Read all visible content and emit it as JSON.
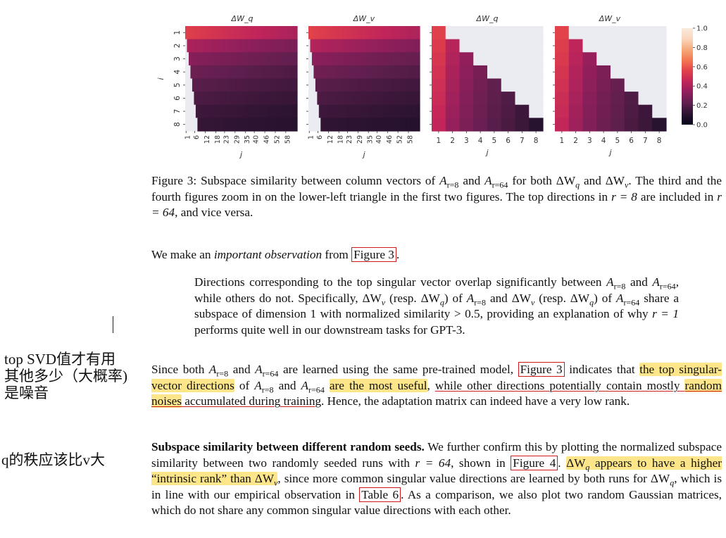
{
  "figure": {
    "panel_titles": [
      "ΔW_q",
      "ΔW_v",
      "ΔW_q",
      "ΔW_v"
    ],
    "ylabel": "i",
    "xlabel": "j",
    "row_ticks": [
      "1",
      "2",
      "3",
      "4",
      "5",
      "6",
      "7",
      "8"
    ],
    "wide_xticks": [
      "1",
      "6",
      "12",
      "18",
      "23",
      "29",
      "35",
      "40",
      "46",
      "52",
      "58"
    ],
    "zoom_xticks": [
      "1",
      "2",
      "3",
      "4",
      "5",
      "6",
      "7",
      "8"
    ],
    "colorbar_ticks": [
      "0.0",
      "0.2",
      "0.4",
      "0.6",
      "0.8",
      "1.0"
    ],
    "colormap": [
      "#03051a",
      "#2b1331",
      "#5e1f4e",
      "#8f1f5c",
      "#c1255a",
      "#e1414a",
      "#f37651",
      "#f6a97a",
      "#f8d6bd",
      "#faebdd"
    ]
  },
  "chart_data": [
    {
      "type": "heatmap",
      "title": "ΔW_q",
      "xlabel": "j",
      "ylabel": "i",
      "x_tick_labels": [
        "1",
        "6",
        "12",
        "18",
        "23",
        "29",
        "35",
        "40",
        "46",
        "52",
        "58"
      ],
      "y_tick_labels": [
        "1",
        "2",
        "3",
        "4",
        "5",
        "6",
        "7",
        "8"
      ],
      "row_values": [
        0.55,
        0.4,
        0.32,
        0.26,
        0.22,
        0.19,
        0.16,
        0.14
      ],
      "masked": "lower-left triangle (j < i) shown blank",
      "colorbar_range": [
        0.0,
        1.0
      ]
    },
    {
      "type": "heatmap",
      "title": "ΔW_v",
      "xlabel": "j",
      "ylabel": "i",
      "x_tick_labels": [
        "1",
        "6",
        "12",
        "18",
        "23",
        "29",
        "35",
        "40",
        "46",
        "52",
        "58"
      ],
      "y_tick_labels": [
        "1",
        "2",
        "3",
        "4",
        "5",
        "6",
        "7",
        "8"
      ],
      "row_values": [
        0.56,
        0.42,
        0.33,
        0.27,
        0.22,
        0.19,
        0.16,
        0.13
      ],
      "masked": "lower-left triangle (j < i) shown blank",
      "colorbar_range": [
        0.0,
        1.0
      ]
    },
    {
      "type": "heatmap",
      "title": "ΔW_q",
      "xlabel": "j",
      "x_tick_labels": [
        "1",
        "2",
        "3",
        "4",
        "5",
        "6",
        "7",
        "8"
      ],
      "y_tick_labels": [
        "1",
        "2",
        "3",
        "4",
        "5",
        "6",
        "7",
        "8"
      ],
      "diagonal_values": [
        0.55,
        0.42,
        0.34,
        0.28,
        0.23,
        0.19,
        0.15,
        0.1
      ],
      "masked": "upper-right triangle (j > i) shown blank",
      "colorbar_range": [
        0.0,
        1.0
      ]
    },
    {
      "type": "heatmap",
      "title": "ΔW_v",
      "xlabel": "j",
      "x_tick_labels": [
        "1",
        "2",
        "3",
        "4",
        "5",
        "6",
        "7",
        "8"
      ],
      "y_tick_labels": [
        "1",
        "2",
        "3",
        "4",
        "5",
        "6",
        "7",
        "8"
      ],
      "diagonal_values": [
        0.56,
        0.44,
        0.35,
        0.29,
        0.24,
        0.19,
        0.15,
        0.1
      ],
      "masked": "upper-right triangle (j > i) shown blank",
      "colorbar_range": [
        0.0,
        1.0
      ]
    }
  ],
  "caption": {
    "label": "Figure 3:",
    "t1": " Subspace similarity between column vectors of ",
    "t2": " and ",
    "t3": " for both ",
    "t4": " and ",
    "t5": ". The third and the fourth figures zoom in on the lower-left triangle in the first two figures. The top directions in ",
    "t6": " are included in ",
    "t7": ", and vice versa.",
    "a": "A",
    "sub8": "r=8",
    "sub64": "r=64",
    "dwq": "ΔW",
    "q": "q",
    "v": "v",
    "r8": "r = 8",
    "r64": "r = 64"
  },
  "p1": {
    "t1": "We make an ",
    "emph": "important observation",
    "t2": " from ",
    "ref": "Figure 3",
    "t3": "."
  },
  "quote": {
    "t1": "Directions corresponding to the top singular vector overlap significantly between ",
    "t2": " and ",
    "t3": ", while others do not.  Specifically, ",
    "t4": " (resp. ",
    "t5": ") of ",
    "t6": " and ",
    "t7": " (resp. ",
    "t8": ") of ",
    "t9": " share a subspace of dimension 1 with normalized similarity ",
    "gt": "> 0.5",
    "t10": ", providing an explanation of why ",
    "r1": "r = 1",
    "t11": " performs quite well in our downstream tasks for GPT-3."
  },
  "p2": {
    "t1": "Since both ",
    "t2": " and ",
    "t3": " are learned using the same pre-trained model, ",
    "ref": "Figure 3",
    "t4": " indicates that ",
    "h1": "the top singular-vector directions",
    "t5": " of ",
    "t6": " and ",
    "h2": "are the most useful",
    "t7": ", ",
    "u1": "while other directions potentially contain mostly ",
    "h3": "random noises",
    "u2": " accumulated during training",
    "t8": ". Hence, the adaptation matrix can indeed have a very low rank."
  },
  "p3": {
    "bold": "Subspace similarity between different random seeds.",
    "t1": "  We further confirm this by plotting the normalized subspace similarity between two randomly seeded runs with ",
    "r64": "r = 64",
    "t2": ", shown in ",
    "ref1": "Figure 4",
    "t3": ". ",
    "h1": " appears to have a higher “intrinsic rank” than ",
    "t4": ", since more common singular value directions are learned by both runs for ",
    "t5": ", which is in line with our empirical observation in ",
    "ref2": "Table 6",
    "t6": ". As a comparison, we also plot two random Gaussian matrices, which do not share any common singular value directions with each other."
  },
  "notes": {
    "n1_l1": "top SVD值才有用",
    "n1_l2": "其他多少（大概率)",
    "n1_l3": "是噪音",
    "n2": "q的秩应该比v大"
  }
}
